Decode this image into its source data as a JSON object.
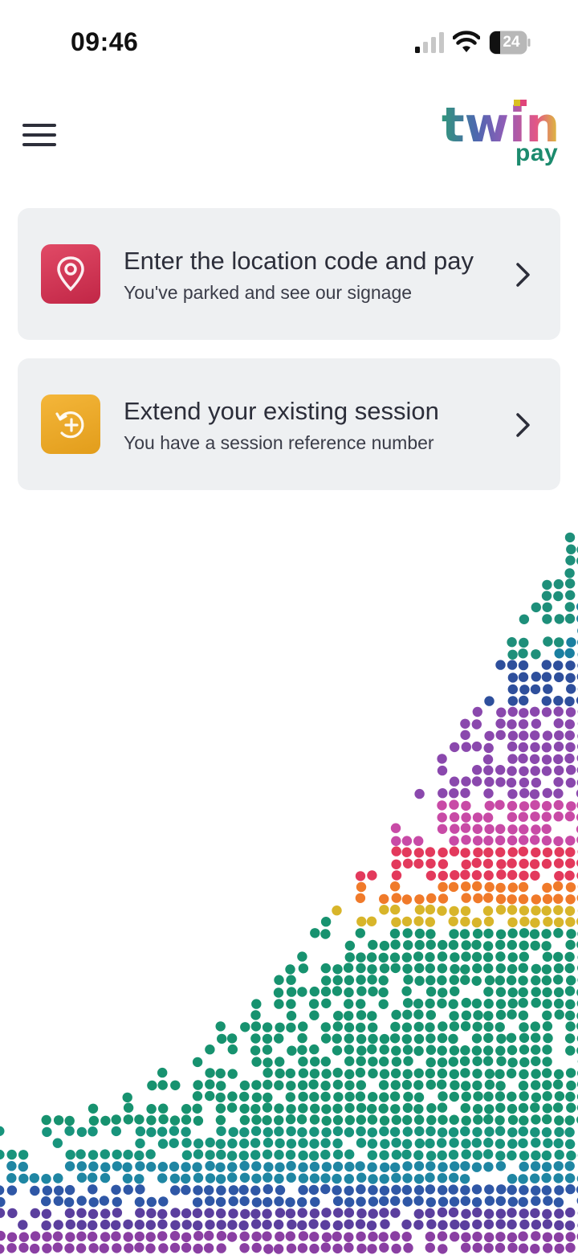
{
  "status_bar": {
    "time": "09:46",
    "battery_level": "24"
  },
  "header": {
    "logo_text": "twin",
    "logo_subtext": "pay",
    "logo_colors": [
      "#1c8b6e",
      "#3b57a8",
      "#8a4bb0",
      "#e0447a",
      "#f08a2a",
      "#d9c021"
    ]
  },
  "options": [
    {
      "title": "Enter the location code and pay",
      "subtitle": "You've parked and see our signage",
      "icon": "location-pin-icon",
      "icon_color": "#d5385a"
    },
    {
      "title": "Extend your existing session",
      "subtitle": "You have a session reference number",
      "icon": "clock-add-icon",
      "icon_color": "#efad2e"
    }
  ],
  "theme": {
    "card_background": "#eef0f2",
    "text_color": "#2c2e3a"
  }
}
